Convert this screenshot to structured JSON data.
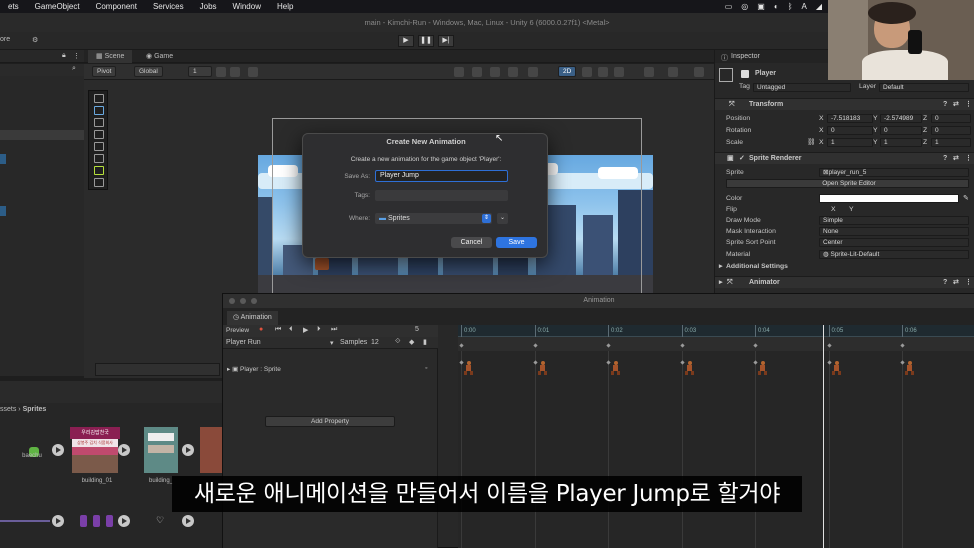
{
  "menubar": {
    "items": [
      "ets",
      "GameObject",
      "Component",
      "Services",
      "Jobs",
      "Window",
      "Help"
    ]
  },
  "window_title": "main - Kimchi-Run - Windows, Mac, Linux - Unity 6 (6000.0.27f1) <Metal>",
  "hierarchy": {
    "more_label": "ore"
  },
  "scene": {
    "tabs": [
      "Scene",
      "Game"
    ],
    "pivot": "Pivot",
    "global": "Global",
    "grid_value": "1",
    "mode_2d": "2D"
  },
  "dialog": {
    "title": "Create New Animation",
    "message": "Create a new animation for the game object 'Player':",
    "save_as_label": "Save As:",
    "save_as_value": "Player Jump",
    "tags_label": "Tags:",
    "where_label": "Where:",
    "where_value": "Sprites",
    "cancel": "Cancel",
    "save": "Save"
  },
  "animation": {
    "window_title": "Animation",
    "tab": "Animation",
    "preview": "Preview",
    "frame": "5",
    "clip": "Player Run",
    "samples_label": "Samples",
    "samples": "12",
    "property": "Player : Sprite",
    "add_property": "Add Property",
    "ruler": [
      "0:00",
      "0:01",
      "0:02",
      "0:03",
      "0:04",
      "0:05",
      "0:06"
    ]
  },
  "project": {
    "breadcrumb": [
      "ssets",
      "Sprites"
    ],
    "items": [
      {
        "label": "baechu",
        "icon": "cabbage-icon"
      },
      {
        "label": "building_01",
        "icon": "building-icon"
      },
      {
        "label": "building_",
        "icon": "building-icon"
      }
    ],
    "building_sign": "우리김밥천국",
    "building_sub": "삼봉주 김치 식품회사"
  },
  "inspector": {
    "tab": "Inspector",
    "object_name": "Player",
    "tag_label": "Tag",
    "tag_value": "Untagged",
    "layer_label": "Layer",
    "layer_value": "Default",
    "transform": {
      "title": "Transform",
      "position_label": "Position",
      "rotation_label": "Rotation",
      "scale_label": "Scale",
      "position": {
        "x": "-7.518183",
        "y": "-2.574989",
        "z": "0"
      },
      "rotation": {
        "x": "0",
        "y": "0",
        "z": "0"
      },
      "scale": {
        "x": "1",
        "y": "1",
        "z": "1"
      }
    },
    "sprite_renderer": {
      "title": "Sprite Renderer",
      "sprite_label": "Sprite",
      "sprite_value": "player_run_5",
      "open_editor": "Open Sprite Editor",
      "color_label": "Color",
      "flip_label": "Flip",
      "flip_x": "X",
      "flip_y": "Y",
      "draw_mode_label": "Draw Mode",
      "draw_mode": "Simple",
      "mask_label": "Mask Interaction",
      "mask": "None",
      "sort_point_label": "Sprite Sort Point",
      "sort_point": "Center",
      "material_label": "Material",
      "material": "Sprite-Lit-Default",
      "additional": "Additional Settings"
    },
    "animator": {
      "title": "Animator"
    }
  },
  "subtitle": "새로운 애니메이션을 만들어서 이름을 Player Jump로 할거야",
  "colors": {
    "accent": "#2e74e0",
    "selection": "#2c5d87",
    "sky": "#8ec3ec"
  }
}
